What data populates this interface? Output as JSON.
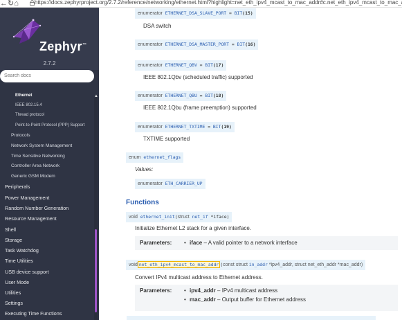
{
  "browser": {
    "url": "https://docs.zephyrproject.org/2.7.2/reference/networking/ethernet.html?highlight=net_eth_ipv4_mcast_to_mac_addr#c.net_eth_ipv4_mcast_to_mac_addr",
    "back_glyph": "←",
    "reload_glyph": "↻",
    "home_glyph": "⌂"
  },
  "sidebar": {
    "brand": "Zephyr",
    "tm": "™",
    "version": "2.7.2",
    "search_placeholder": "Search docs",
    "items": [
      {
        "label": "Ethernet",
        "level": 3,
        "active": true
      },
      {
        "label": "IEEE 802.15.4",
        "level": 3
      },
      {
        "label": "Thread protocol",
        "level": 3
      },
      {
        "label": "Point-to-Point Protocol (PPP) Support",
        "level": 3
      },
      {
        "label": "Protocols",
        "level": 2
      },
      {
        "label": "Network System Management",
        "level": 2
      },
      {
        "label": "Time Sensitive Networking",
        "level": 2
      },
      {
        "label": "Controller Area Network",
        "level": 2
      },
      {
        "label": "Generic GSM Modem",
        "level": 2
      },
      {
        "label": "Peripherals",
        "level": 1
      },
      {
        "label": "Power Management",
        "level": 1
      },
      {
        "label": "Random Number Generation",
        "level": 1
      },
      {
        "label": "Resource Management",
        "level": 1
      },
      {
        "label": "Shell",
        "level": 1
      },
      {
        "label": "Storage",
        "level": 1
      },
      {
        "label": "Task Watchdog",
        "level": 1
      },
      {
        "label": "Time Utilities",
        "level": 1
      },
      {
        "label": "USB device support",
        "level": 1
      },
      {
        "label": "User Mode",
        "level": 1
      },
      {
        "label": "Utilities",
        "level": 1
      },
      {
        "label": "Settings",
        "level": 1
      },
      {
        "label": "Executing Time Functions",
        "level": 1
      }
    ]
  },
  "content": {
    "enum_kw": "enumerator",
    "enumerators": [
      {
        "name": "ETHERNET_DSA_SLAVE_PORT",
        "eq": " = ",
        "bit": "BIT",
        "num": "(15)",
        "desc": "DSA switch"
      },
      {
        "name": "ETHERNET_DSA_MASTER_PORT",
        "eq": " = ",
        "bit": "BIT",
        "num": "(16)",
        "desc": ""
      },
      {
        "name": "ETHERNET_QBV",
        "eq": " = ",
        "bit": "BIT",
        "num": "(17)",
        "desc": "IEEE 802.1Qbv (scheduled traffic) supported"
      },
      {
        "name": "ETHERNET_QBU",
        "eq": " = ",
        "bit": "BIT",
        "num": "(18)",
        "desc": "IEEE 802.1Qbu (frame preemption) supported"
      },
      {
        "name": "ETHERNET_TXTIME",
        "eq": " = ",
        "bit": "BIT",
        "num": "(19)",
        "desc": "TXTIME supported"
      }
    ],
    "flags_enum": {
      "kw": "enum",
      "name": "ethernet_flags"
    },
    "values_label": "Values:",
    "carrier_up": "ETH_CARRIER_UP",
    "functions_title": "Functions",
    "fn1": {
      "ret": "void",
      "name": "ethernet_init",
      "open": "(",
      "struct_kw": "struct",
      "arg_type": "net_if",
      "arg": " *iface)",
      "desc": "Initialize Ethernet L2 stack for a given interface.",
      "params_label": "Parameters:",
      "params": [
        {
          "name": "iface",
          "desc": " – A valid pointer to a network interface"
        }
      ]
    },
    "fn2": {
      "ret": "void",
      "name": "net_eth_ipv4_mcast_to_mac_addr",
      "open": "(",
      "const_struct": "const struct ",
      "arg1_type": "in_addr",
      "arg1": " *ipv4_addr, struct net_eth_addr *mac_addr)",
      "desc": "Convert IPv4 multicast address to Ethernet address.",
      "params_label": "Parameters:",
      "params": [
        {
          "name": "ipv4_addr",
          "desc": " – IPv4 multicast address"
        },
        {
          "name": "mac_addr",
          "desc": " – Output buffer for Ethernet address"
        }
      ]
    },
    "bullet": "•"
  }
}
